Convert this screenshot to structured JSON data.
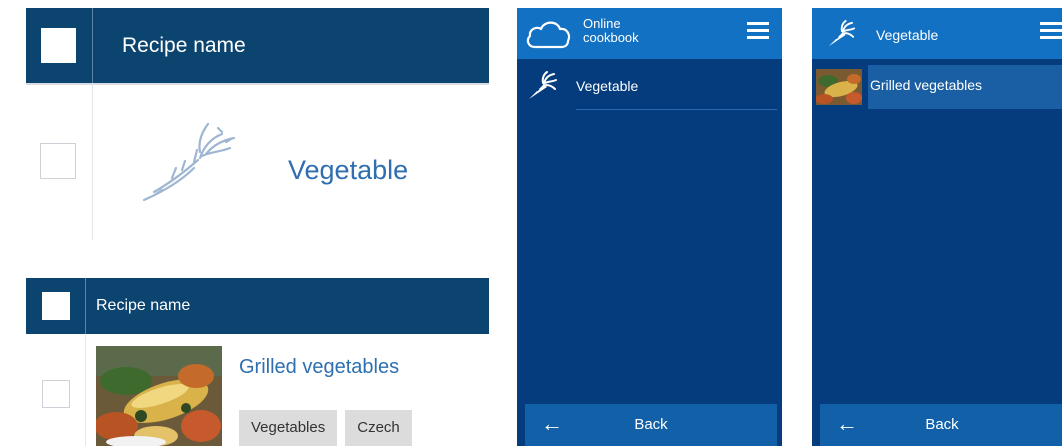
{
  "category_table": {
    "header": {
      "column_title": "Recipe name"
    },
    "rows": [
      {
        "name": "Vegetable",
        "icon": "carrot-icon"
      }
    ]
  },
  "recipe_table": {
    "header": {
      "column_title": "Recipe name"
    },
    "rows": [
      {
        "name": "Grilled vegetables",
        "tags": [
          "Vegetables",
          "Czech"
        ]
      }
    ]
  },
  "phone_home": {
    "app_title_line1": "Online",
    "app_title_line2": "cookbook",
    "logo_icon": "cloud-icon",
    "menu_icon": "hamburger-menu-icon",
    "items": [
      {
        "label": "Vegetable",
        "icon": "carrot-icon"
      }
    ],
    "back_arrow": "←",
    "back_label": "Back"
  },
  "phone_category": {
    "title": "Vegetable",
    "title_icon": "carrot-icon",
    "menu_icon": "hamburger-menu-icon",
    "items": [
      {
        "label": "Grilled vegetables"
      }
    ],
    "back_arrow": "←",
    "back_label": "Back"
  },
  "colors": {
    "table_header": "#0c4470",
    "link_text": "#2f6fb0",
    "phone_bg": "#053c7e",
    "phone_topbar": "#1271c2",
    "phone_bottombar": "#1160a8",
    "tag_bg": "#dcdcdc"
  }
}
